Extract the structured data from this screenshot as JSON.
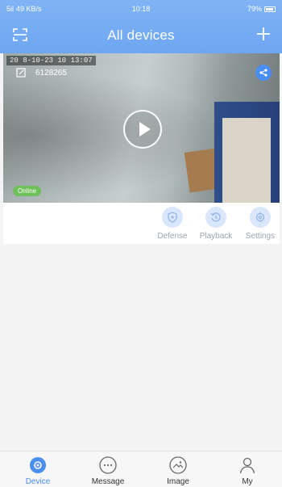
{
  "status_bar": {
    "signal": "5il",
    "network_speed": "49 KB/s",
    "time": "10:18",
    "battery": "79%"
  },
  "header": {
    "title": "All devices"
  },
  "camera": {
    "timestamp": "20 8-10-23 10 13:07",
    "name": "6128265",
    "status": "Online",
    "actions": [
      {
        "label": "Defense",
        "icon": "shield-icon"
      },
      {
        "label": "Playback",
        "icon": "history-icon"
      },
      {
        "label": "Settings",
        "icon": "gear-icon"
      }
    ]
  },
  "tabbar": {
    "tabs": [
      {
        "label": "Device",
        "icon": "device-icon",
        "active": true
      },
      {
        "label": "Message",
        "icon": "message-icon",
        "active": false
      },
      {
        "label": "Image",
        "icon": "image-icon",
        "active": false
      },
      {
        "label": "My",
        "icon": "user-icon",
        "active": false
      }
    ]
  },
  "colors": {
    "header": "#7fb3f4",
    "accent": "#4a8ef0",
    "online": "#6fbf5a",
    "action_circle": "#d9e6fb"
  }
}
